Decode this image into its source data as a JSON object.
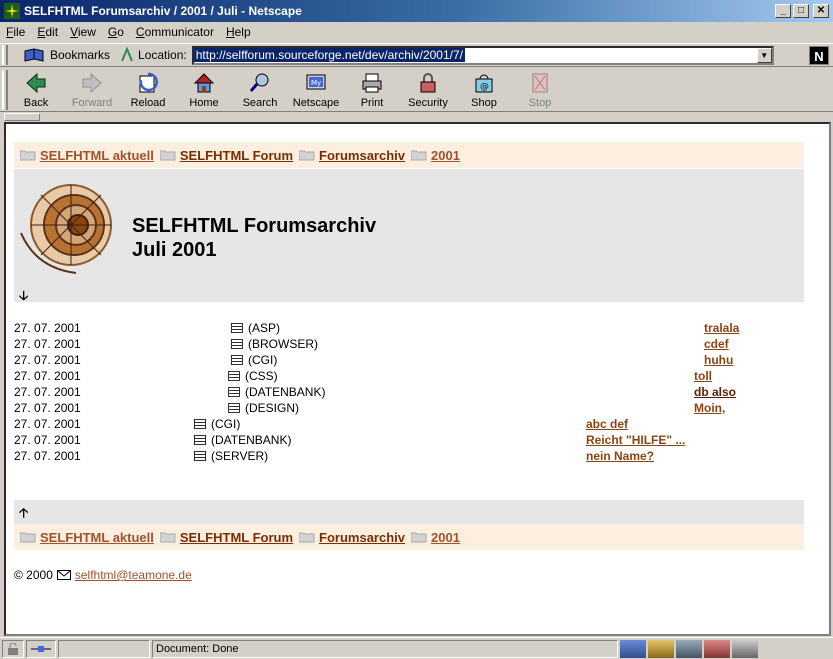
{
  "window": {
    "title": "SELFHTML Forumsarchiv / 2001 / Juli - Netscape"
  },
  "menu": [
    "File",
    "Edit",
    "View",
    "Go",
    "Communicator",
    "Help"
  ],
  "locationbar": {
    "bookmarks_label": "Bookmarks",
    "location_label": "Location:",
    "url": "http://selfforum.sourceforge.net/dev/archiv/2001/7/"
  },
  "toolbar": [
    {
      "label": "Back",
      "icon": "back-arrow-icon",
      "enabled": true
    },
    {
      "label": "Forward",
      "icon": "forward-arrow-icon",
      "enabled": false
    },
    {
      "label": "Reload",
      "icon": "reload-icon",
      "enabled": true
    },
    {
      "label": "Home",
      "icon": "home-icon",
      "enabled": true
    },
    {
      "label": "Search",
      "icon": "search-icon",
      "enabled": true
    },
    {
      "label": "Netscape",
      "icon": "netscape-icon",
      "enabled": true
    },
    {
      "label": "Print",
      "icon": "print-icon",
      "enabled": true
    },
    {
      "label": "Security",
      "icon": "lock-icon",
      "enabled": true
    },
    {
      "label": "Shop",
      "icon": "shop-icon",
      "enabled": true
    },
    {
      "label": "Stop",
      "icon": "stop-icon",
      "enabled": false
    }
  ],
  "breadcrumb": [
    {
      "label": "SELFHTML aktuell"
    },
    {
      "label": "SELFHTML Forum"
    },
    {
      "label": "Forumsarchiv"
    },
    {
      "label": "2001"
    }
  ],
  "header": {
    "title_line1": "SELFHTML Forumsarchiv",
    "title_line2": "Juli 2001",
    "down_arrow": "🡣",
    "up_arrow": "🡡"
  },
  "threads": [
    {
      "date": "27. 07. 2001",
      "topic": "(ASP)",
      "user": "tralala"
    },
    {
      "date": "27. 07. 2001",
      "topic": "(BROWSER)",
      "user": "cdef"
    },
    {
      "date": "27. 07. 2001",
      "topic": "(CGI)",
      "user": "huhu"
    },
    {
      "date": "27. 07. 2001",
      "topic": "(CSS)",
      "user": "toll"
    },
    {
      "date": "27. 07. 2001",
      "topic": "(DATENBANK)",
      "user": "db also"
    },
    {
      "date": "27. 07. 2001",
      "topic": "(DESIGN)",
      "user": "Moin,"
    },
    {
      "date": "27. 07. 2001",
      "topic": "(CGI)",
      "user": "abc def"
    },
    {
      "date": "27. 07. 2001",
      "topic": "(DATENBANK)",
      "user": "Reicht \"HILFE\" ..."
    },
    {
      "date": "27. 07. 2001",
      "topic": "(SERVER)",
      "user": "nein Name?"
    }
  ],
  "footer": {
    "copyright": "© 2000",
    "email": "selfhtml@teamone.de"
  },
  "statusbar": {
    "text": "Document: Done"
  },
  "colors": {
    "link": "#a0522d",
    "breadcrumb_bg": "#fdefe0",
    "header_bg": "#e6e6e6",
    "title_bar": "#0a246a"
  }
}
